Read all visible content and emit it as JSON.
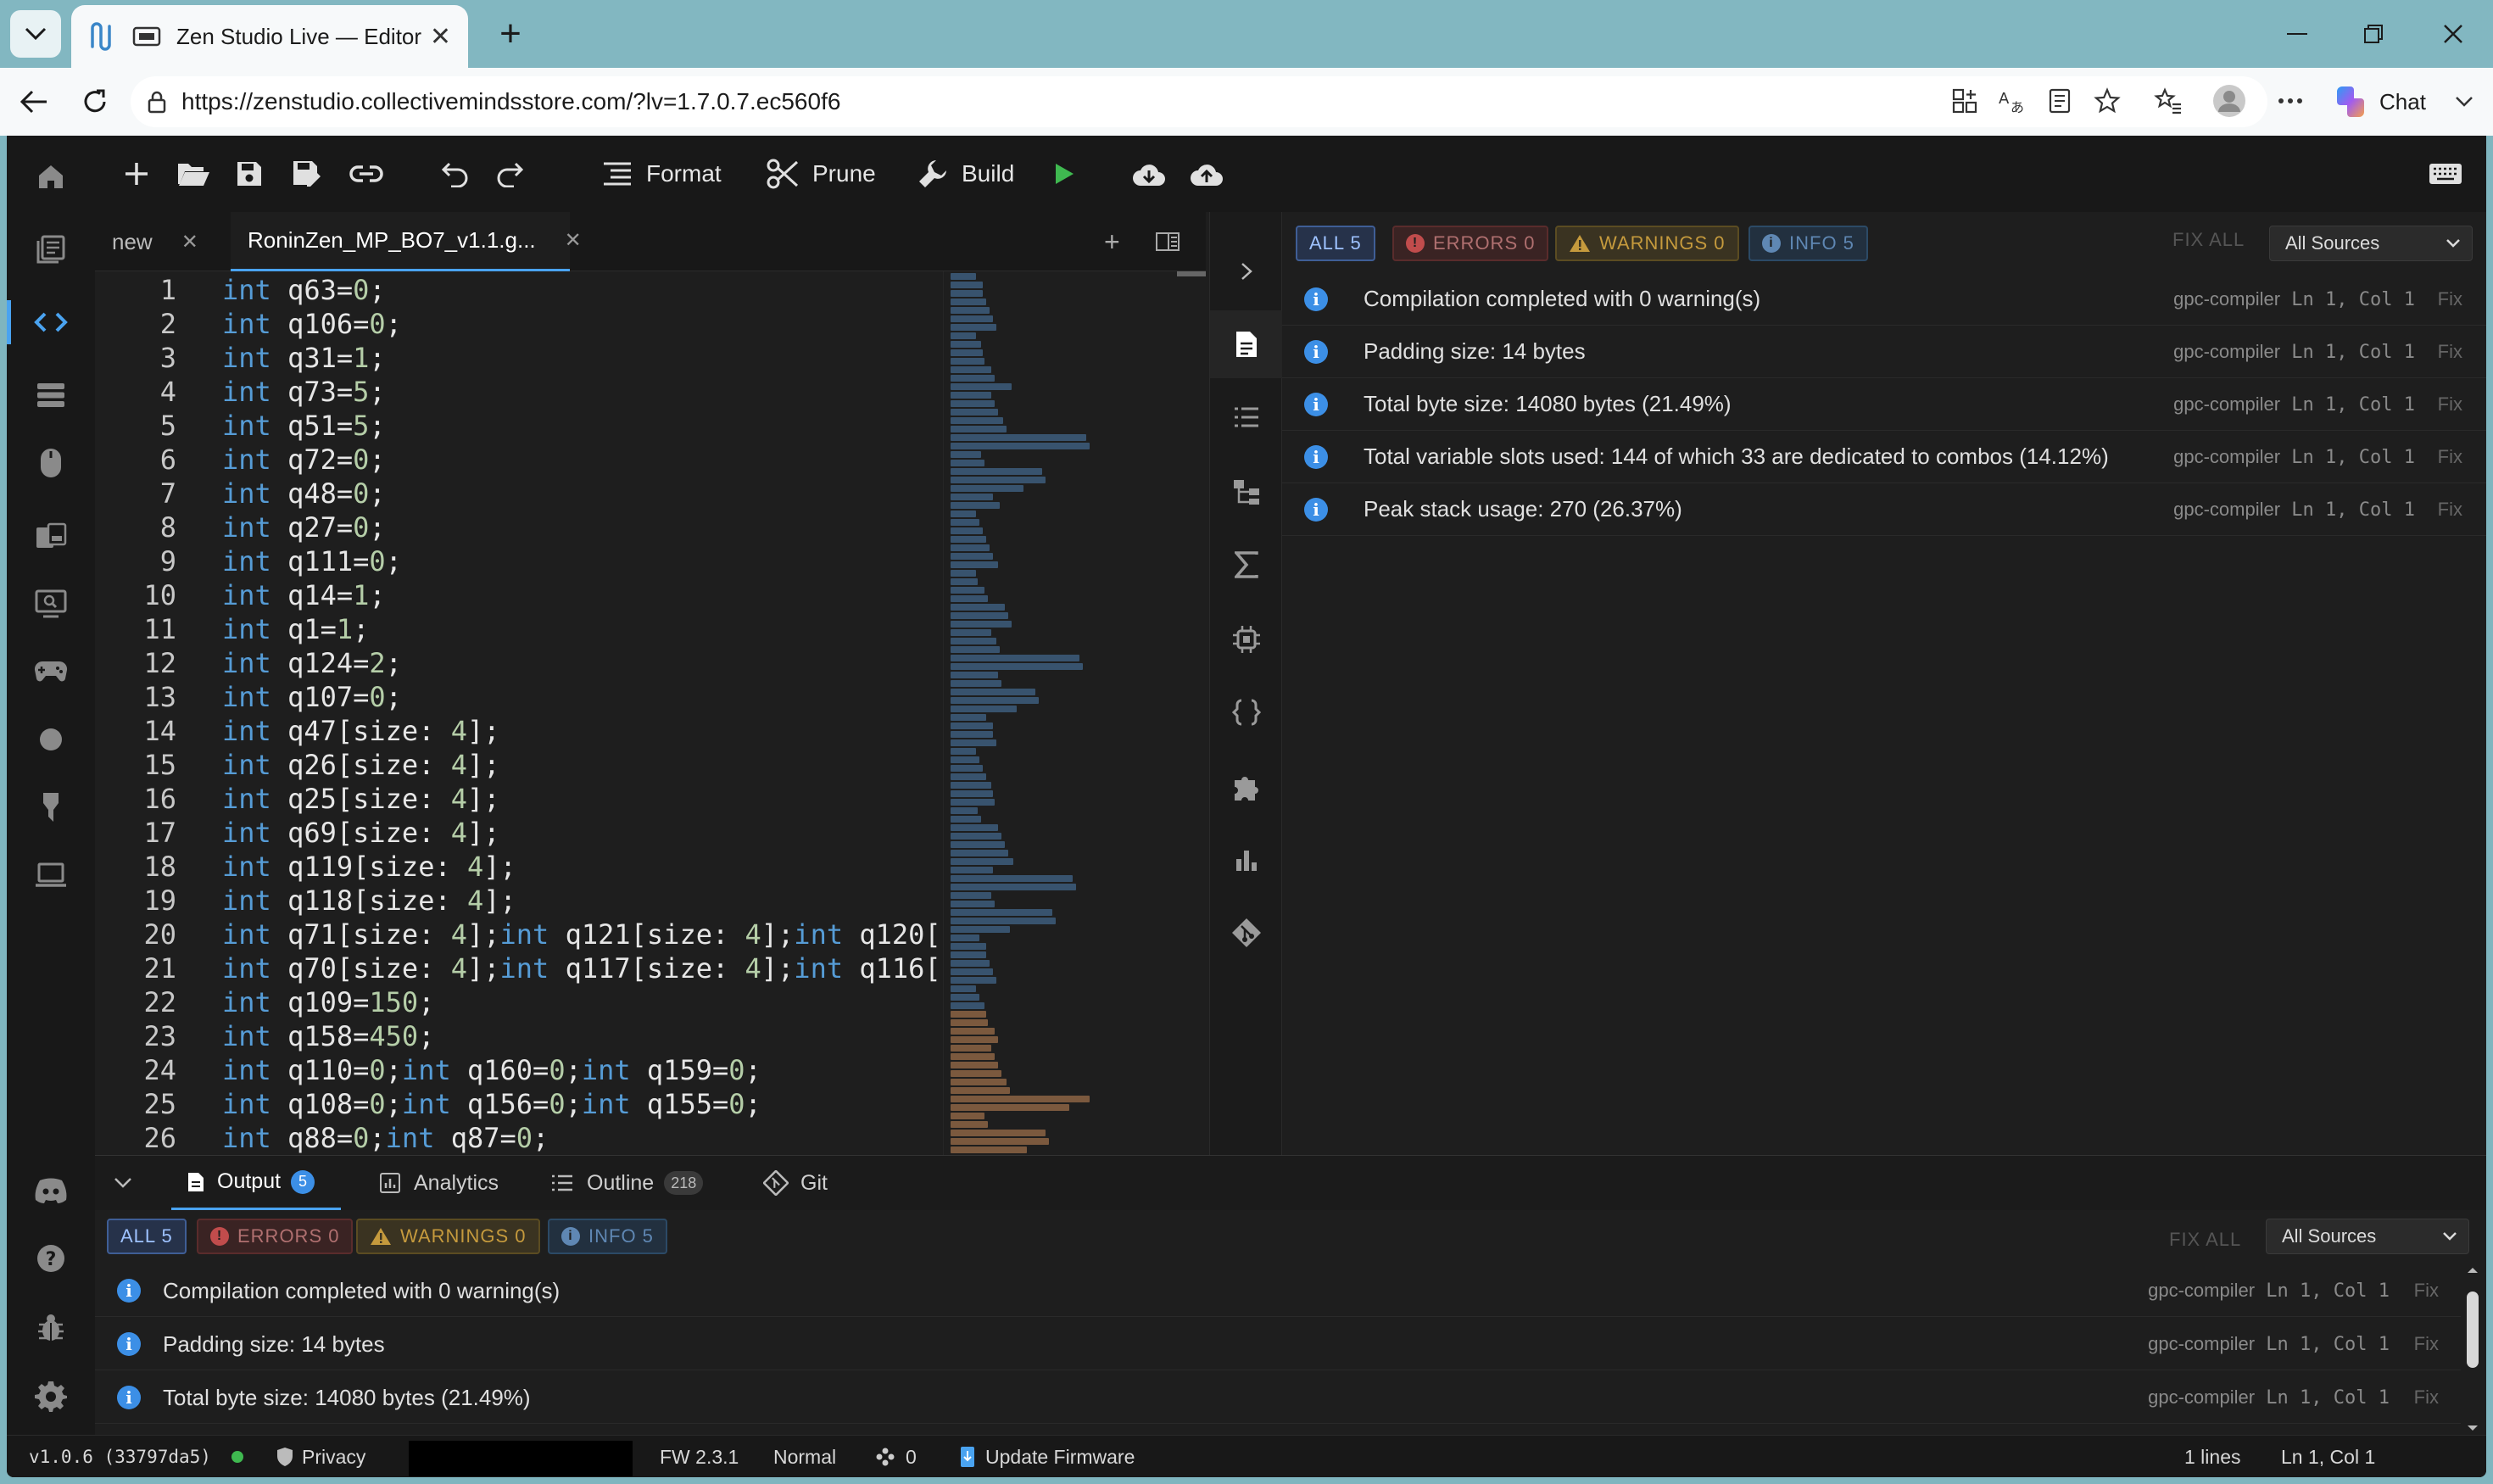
{
  "browser": {
    "tab_title": "Zen Studio Live — Editor",
    "url": "https://zenstudio.collectivemindsstore.com/?lv=1.7.0.7.ec560f6",
    "chat_label": "Chat"
  },
  "toolbar": {
    "format_label": "Format",
    "prune_label": "Prune",
    "build_label": "Build"
  },
  "editor": {
    "tabs": [
      {
        "label": "new"
      },
      {
        "label": "RoninZen_MP_BO7_v1.1.g..."
      }
    ],
    "lines": [
      {
        "n": "1",
        "tokens": [
          [
            "kw",
            "int"
          ],
          [
            "t",
            " q63"
          ],
          [
            "p",
            "="
          ],
          [
            "num",
            "0"
          ],
          [
            "p",
            ";"
          ]
        ]
      },
      {
        "n": "2",
        "tokens": [
          [
            "kw",
            "int"
          ],
          [
            "t",
            " q106"
          ],
          [
            "p",
            "="
          ],
          [
            "num",
            "0"
          ],
          [
            "p",
            ";"
          ]
        ]
      },
      {
        "n": "3",
        "tokens": [
          [
            "kw",
            "int"
          ],
          [
            "t",
            " q31"
          ],
          [
            "p",
            "="
          ],
          [
            "num",
            "1"
          ],
          [
            "p",
            ";"
          ]
        ]
      },
      {
        "n": "4",
        "tokens": [
          [
            "kw",
            "int"
          ],
          [
            "t",
            " q73"
          ],
          [
            "p",
            "="
          ],
          [
            "num",
            "5"
          ],
          [
            "p",
            ";"
          ]
        ]
      },
      {
        "n": "5",
        "tokens": [
          [
            "kw",
            "int"
          ],
          [
            "t",
            " q51"
          ],
          [
            "p",
            "="
          ],
          [
            "num",
            "5"
          ],
          [
            "p",
            ";"
          ]
        ]
      },
      {
        "n": "6",
        "tokens": [
          [
            "kw",
            "int"
          ],
          [
            "t",
            " q72"
          ],
          [
            "p",
            "="
          ],
          [
            "num",
            "0"
          ],
          [
            "p",
            ";"
          ]
        ]
      },
      {
        "n": "7",
        "tokens": [
          [
            "kw",
            "int"
          ],
          [
            "t",
            " q48"
          ],
          [
            "p",
            "="
          ],
          [
            "num",
            "0"
          ],
          [
            "p",
            ";"
          ]
        ]
      },
      {
        "n": "8",
        "tokens": [
          [
            "kw",
            "int"
          ],
          [
            "t",
            " q27"
          ],
          [
            "p",
            "="
          ],
          [
            "num",
            "0"
          ],
          [
            "p",
            ";"
          ]
        ]
      },
      {
        "n": "9",
        "tokens": [
          [
            "kw",
            "int"
          ],
          [
            "t",
            " q111"
          ],
          [
            "p",
            "="
          ],
          [
            "num",
            "0"
          ],
          [
            "p",
            ";"
          ]
        ]
      },
      {
        "n": "10",
        "tokens": [
          [
            "kw",
            "int"
          ],
          [
            "t",
            " q14"
          ],
          [
            "p",
            "="
          ],
          [
            "num",
            "1"
          ],
          [
            "p",
            ";"
          ]
        ]
      },
      {
        "n": "11",
        "tokens": [
          [
            "kw",
            "int"
          ],
          [
            "t",
            " q1"
          ],
          [
            "p",
            "="
          ],
          [
            "num",
            "1"
          ],
          [
            "p",
            ";"
          ]
        ]
      },
      {
        "n": "12",
        "tokens": [
          [
            "kw",
            "int"
          ],
          [
            "t",
            " q124"
          ],
          [
            "p",
            "="
          ],
          [
            "num",
            "2"
          ],
          [
            "p",
            ";"
          ]
        ]
      },
      {
        "n": "13",
        "tokens": [
          [
            "kw",
            "int"
          ],
          [
            "t",
            " q107"
          ],
          [
            "p",
            "="
          ],
          [
            "num",
            "0"
          ],
          [
            "p",
            ";"
          ]
        ]
      },
      {
        "n": "14",
        "tokens": [
          [
            "kw",
            "int"
          ],
          [
            "t",
            " q47"
          ],
          [
            "p",
            "[size: "
          ],
          [
            "num",
            "4"
          ],
          [
            "p",
            "];"
          ]
        ]
      },
      {
        "n": "15",
        "tokens": [
          [
            "kw",
            "int"
          ],
          [
            "t",
            " q26"
          ],
          [
            "p",
            "[size: "
          ],
          [
            "num",
            "4"
          ],
          [
            "p",
            "];"
          ]
        ]
      },
      {
        "n": "16",
        "tokens": [
          [
            "kw",
            "int"
          ],
          [
            "t",
            " q25"
          ],
          [
            "p",
            "[size: "
          ],
          [
            "num",
            "4"
          ],
          [
            "p",
            "];"
          ]
        ]
      },
      {
        "n": "17",
        "tokens": [
          [
            "kw",
            "int"
          ],
          [
            "t",
            " q69"
          ],
          [
            "p",
            "[size: "
          ],
          [
            "num",
            "4"
          ],
          [
            "p",
            "];"
          ]
        ]
      },
      {
        "n": "18",
        "tokens": [
          [
            "kw",
            "int"
          ],
          [
            "t",
            " q119"
          ],
          [
            "p",
            "[size: "
          ],
          [
            "num",
            "4"
          ],
          [
            "p",
            "];"
          ]
        ]
      },
      {
        "n": "19",
        "tokens": [
          [
            "kw",
            "int"
          ],
          [
            "t",
            " q118"
          ],
          [
            "p",
            "[size: "
          ],
          [
            "num",
            "4"
          ],
          [
            "p",
            "];"
          ]
        ]
      },
      {
        "n": "20",
        "tokens": [
          [
            "kw",
            "int"
          ],
          [
            "t",
            " q71"
          ],
          [
            "p",
            "[size: "
          ],
          [
            "num",
            "4"
          ],
          [
            "p",
            "];"
          ],
          [
            "kw",
            "int"
          ],
          [
            "t",
            " q121"
          ],
          [
            "p",
            "[size: "
          ],
          [
            "num",
            "4"
          ],
          [
            "p",
            "];"
          ],
          [
            "kw",
            "int"
          ],
          [
            "t",
            " q120["
          ]
        ]
      },
      {
        "n": "21",
        "tokens": [
          [
            "kw",
            "int"
          ],
          [
            "t",
            " q70"
          ],
          [
            "p",
            "[size: "
          ],
          [
            "num",
            "4"
          ],
          [
            "p",
            "];"
          ],
          [
            "kw",
            "int"
          ],
          [
            "t",
            " q117"
          ],
          [
            "p",
            "[size: "
          ],
          [
            "num",
            "4"
          ],
          [
            "p",
            "];"
          ],
          [
            "kw",
            "int"
          ],
          [
            "t",
            " q116["
          ]
        ]
      },
      {
        "n": "22",
        "tokens": [
          [
            "kw",
            "int"
          ],
          [
            "t",
            " q109"
          ],
          [
            "p",
            "="
          ],
          [
            "num",
            "150"
          ],
          [
            "p",
            ";"
          ]
        ]
      },
      {
        "n": "23",
        "tokens": [
          [
            "kw",
            "int"
          ],
          [
            "t",
            " q158"
          ],
          [
            "p",
            "="
          ],
          [
            "num",
            "450"
          ],
          [
            "p",
            ";"
          ]
        ]
      },
      {
        "n": "24",
        "tokens": [
          [
            "kw",
            "int"
          ],
          [
            "t",
            " q110"
          ],
          [
            "p",
            "="
          ],
          [
            "num",
            "0"
          ],
          [
            "p",
            ";"
          ],
          [
            "kw",
            "int"
          ],
          [
            "t",
            " q160"
          ],
          [
            "p",
            "="
          ],
          [
            "num",
            "0"
          ],
          [
            "p",
            ";"
          ],
          [
            "kw",
            "int"
          ],
          [
            "t",
            " q159"
          ],
          [
            "p",
            "="
          ],
          [
            "num",
            "0"
          ],
          [
            "p",
            ";"
          ]
        ]
      },
      {
        "n": "25",
        "tokens": [
          [
            "kw",
            "int"
          ],
          [
            "t",
            " q108"
          ],
          [
            "p",
            "="
          ],
          [
            "num",
            "0"
          ],
          [
            "p",
            ";"
          ],
          [
            "kw",
            "int"
          ],
          [
            "t",
            " q156"
          ],
          [
            "p",
            "="
          ],
          [
            "num",
            "0"
          ],
          [
            "p",
            ";"
          ],
          [
            "kw",
            "int"
          ],
          [
            "t",
            " q155"
          ],
          [
            "p",
            "="
          ],
          [
            "num",
            "0"
          ],
          [
            "p",
            ";"
          ]
        ]
      },
      {
        "n": "26",
        "tokens": [
          [
            "kw",
            "int"
          ],
          [
            "t",
            " q88"
          ],
          [
            "p",
            "="
          ],
          [
            "num",
            "0"
          ],
          [
            "p",
            ";"
          ],
          [
            "kw",
            "int"
          ],
          [
            "t",
            " q87"
          ],
          [
            "p",
            "="
          ],
          [
            "num",
            "0"
          ],
          [
            "p",
            ";"
          ]
        ]
      }
    ]
  },
  "problems": {
    "filters": {
      "all": "ALL 5",
      "errors": "ERRORS 0",
      "warnings": "WARNINGS 0",
      "info": "INFO 5"
    },
    "fix_all": "FIX ALL",
    "sources_select": "All Sources",
    "messages": [
      {
        "text": "Compilation completed with 0 warning(s)",
        "source": "gpc-compiler",
        "pos": "Ln 1, Col 1",
        "fix": "Fix"
      },
      {
        "text": "Padding size: 14 bytes",
        "source": "gpc-compiler",
        "pos": "Ln 1, Col 1",
        "fix": "Fix"
      },
      {
        "text": "Total byte size: 14080 bytes (21.49%)",
        "source": "gpc-compiler",
        "pos": "Ln 1, Col 1",
        "fix": "Fix"
      },
      {
        "text": "Total variable slots used: 144 of which 33 are dedicated to combos (14.12%)",
        "source": "gpc-compiler",
        "pos": "Ln 1, Col 1",
        "fix": "Fix"
      },
      {
        "text": "Peak stack usage: 270 (26.37%)",
        "source": "gpc-compiler",
        "pos": "Ln 1, Col 1",
        "fix": "Fix"
      }
    ]
  },
  "bottom_panel": {
    "tabs": {
      "output": "Output",
      "output_count": "5",
      "analytics": "Analytics",
      "outline": "Outline",
      "outline_count": "218",
      "git": "Git"
    }
  },
  "status_bar": {
    "version": "v1.0.6 (33797da5)",
    "privacy": "Privacy",
    "firmware": "FW 2.3.1",
    "mode": "Normal",
    "connections": "0",
    "update": "Update Firmware",
    "lines": "1 lines",
    "cursor": "Ln 1, Col 1"
  },
  "colors": {
    "accent": "#4aa3f0",
    "info": "#3c8fe6",
    "keyword": "#569cd6",
    "number": "#b5cea8",
    "status_dot": "#3fb950"
  }
}
